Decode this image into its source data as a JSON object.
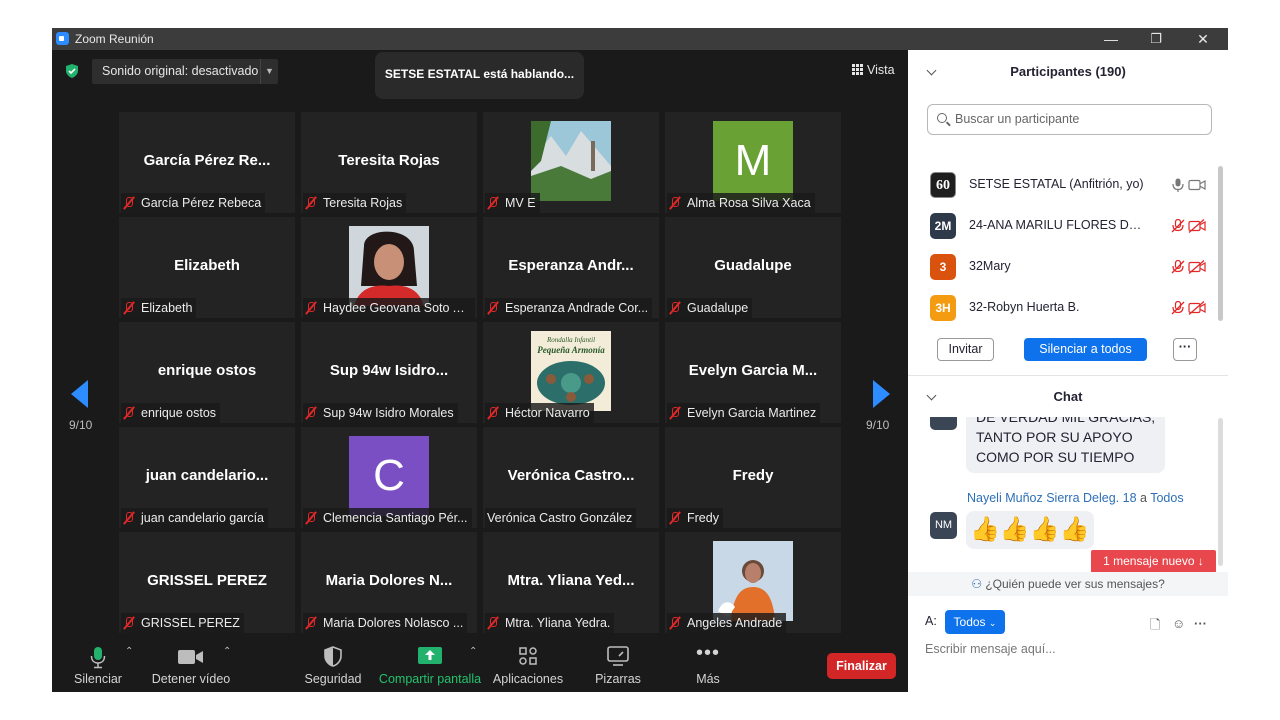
{
  "window": {
    "title": "Zoom Reunión",
    "minimize": "—",
    "restore": "❐",
    "close": "✕"
  },
  "meeting": {
    "sound": "Sonido original: desactivado",
    "speaking": "SETSE ESTATAL está hablando...",
    "view": "Vista",
    "page_left": "9/10",
    "page_right": "9/10"
  },
  "tiles": [
    {
      "big": "García Pérez Re...",
      "name": "García Pérez Rebeca",
      "muted": true
    },
    {
      "big": "Teresita Rojas",
      "name": "Teresita Rojas",
      "muted": true
    },
    {
      "big": "",
      "name": "MV E",
      "muted": true,
      "photo": "landscape"
    },
    {
      "big": "",
      "name": "Alma Rosa Silva Xaca",
      "muted": true,
      "avatar_letter": "M",
      "avatar_color": "#6aa134"
    },
    {
      "big": "Elizabeth",
      "name": "Elizabeth",
      "muted": true
    },
    {
      "big": "",
      "name": "Haydee Geovana Soto A...",
      "muted": true,
      "photo": "portrait"
    },
    {
      "big": "Esperanza Andr...",
      "name": "Esperanza Andrade Cor...",
      "muted": true
    },
    {
      "big": "Guadalupe",
      "name": "Guadalupe",
      "muted": true
    },
    {
      "big": "enrique ostos",
      "name": "enrique ostos",
      "muted": true
    },
    {
      "big": "Sup 94w Isidro...",
      "name": "Sup 94w Isidro Morales",
      "muted": true
    },
    {
      "big": "",
      "name": "Héctor Navarro",
      "muted": true,
      "photo": "logo",
      "logo_line1": "Rondalla Infantil",
      "logo_line2": "Pequeña Armonía"
    },
    {
      "big": "Evelyn Garcia M...",
      "name": "Evelyn Garcia Martinez",
      "muted": true
    },
    {
      "big": "juan candelario...",
      "name": "juan candelario garcía",
      "muted": true
    },
    {
      "big": "",
      "name": "Clemencia Santiago Pér...",
      "muted": true,
      "avatar_letter": "C",
      "avatar_color": "#7b4fc4"
    },
    {
      "big": "Verónica Castro...",
      "name": "Verónica Castro González",
      "muted": false
    },
    {
      "big": "Fredy",
      "name": "Fredy",
      "muted": true
    },
    {
      "big": "GRISSEL PEREZ",
      "name": "GRISSEL PEREZ",
      "muted": true
    },
    {
      "big": "Maria Dolores N...",
      "name": "Maria Dolores Nolasco ...",
      "muted": true
    },
    {
      "big": "Mtra. Yliana Yed...",
      "name": "Mtra. Yliana Yedra.",
      "muted": true
    },
    {
      "big": "",
      "name": "Angeles Andrade",
      "muted": true,
      "photo": "woman"
    }
  ],
  "toolbar": {
    "mute": "Silenciar",
    "video": "Detener vídeo",
    "security": "Seguridad",
    "share": "Compartir pantalla",
    "apps": "Aplicaciones",
    "whiteboards": "Pizarras",
    "more": "Más",
    "end": "Finalizar"
  },
  "participants": {
    "title": "Participantes (190)",
    "search_placeholder": "Buscar un participante",
    "list": [
      {
        "initials": "60",
        "name": "SETSE ESTATAL (Anfitrión, yo)",
        "color": "#1f1f1f",
        "muted": false
      },
      {
        "initials": "2M",
        "name": "24-ANA MARILU FLORES DEL A...",
        "color": "#2e3a4a",
        "muted": true
      },
      {
        "initials": "3",
        "name": "32Mary",
        "color": "#d9530f",
        "muted": true
      },
      {
        "initials": "3H",
        "name": "32-Robyn Huerta B.",
        "color": "#f39c12",
        "muted": true
      }
    ],
    "invite": "Invitar",
    "mute_all": "Silenciar a todos",
    "more": "···"
  },
  "chat": {
    "title": "Chat",
    "msg1": [
      "DE VERDAD MIL GRACIAS,",
      "TANTO POR SU APOYO",
      "COMO POR SU TIEMPO"
    ],
    "sender": "Nayeli Muñoz Sierra Deleg. 18",
    "to_word": "a",
    "recipient": "Todos",
    "sender_initials": "NM",
    "msg2": "👍👍👍👍",
    "new_message": "1 mensaje nuevo ↓",
    "who_can_see": "¿Quién puede ver sus mensajes?",
    "to_label": "A:",
    "to_value": "Todos",
    "input_placeholder": "Escribir mensaje aquí...",
    "more": "···"
  }
}
